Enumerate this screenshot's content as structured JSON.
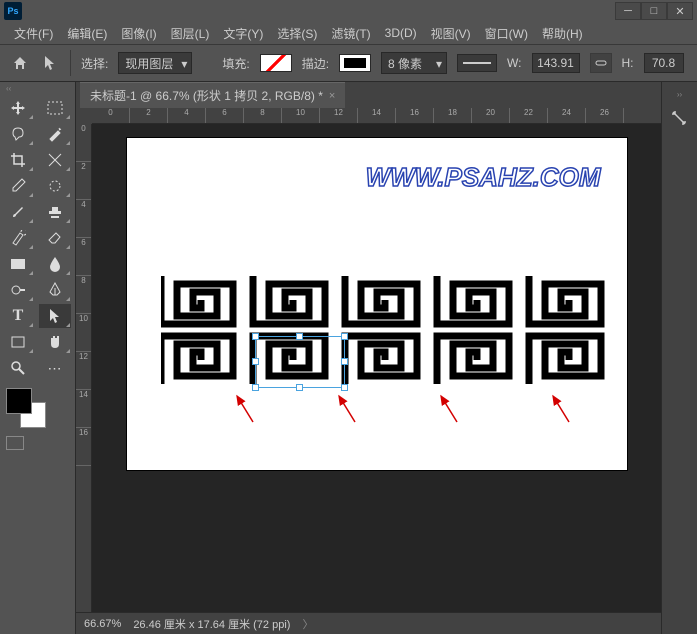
{
  "titlebar": {
    "app": "Ps"
  },
  "menu": {
    "items": [
      "文件(F)",
      "编辑(E)",
      "图像(I)",
      "图层(L)",
      "文字(Y)",
      "选择(S)",
      "滤镜(T)",
      "3D(D)",
      "视图(V)",
      "窗口(W)",
      "帮助(H)"
    ]
  },
  "options": {
    "select_label": "选择:",
    "select_value": "现用图层",
    "fill_label": "填充:",
    "stroke_label": "描边:",
    "stroke_size": "8 像素",
    "w_label": "W:",
    "w_value": "143.91",
    "h_label": "H:",
    "h_value": "70.8"
  },
  "document": {
    "tab_title": "未标题-1 @ 66.7% (形状 1 拷贝 2, RGB/8) *"
  },
  "ruler_h": [
    "0",
    "2",
    "4",
    "6",
    "8",
    "10",
    "12",
    "14",
    "16",
    "18",
    "20",
    "22",
    "24",
    "26"
  ],
  "ruler_v": [
    "0",
    "2",
    "4",
    "6",
    "8",
    "10",
    "12",
    "14",
    "16"
  ],
  "canvas": {
    "watermark": "WWW.PSAHZ.COM"
  },
  "status": {
    "zoom": "66.67%",
    "doc_info": "26.46 厘米 x 17.64 厘米 (72 ppi)"
  }
}
